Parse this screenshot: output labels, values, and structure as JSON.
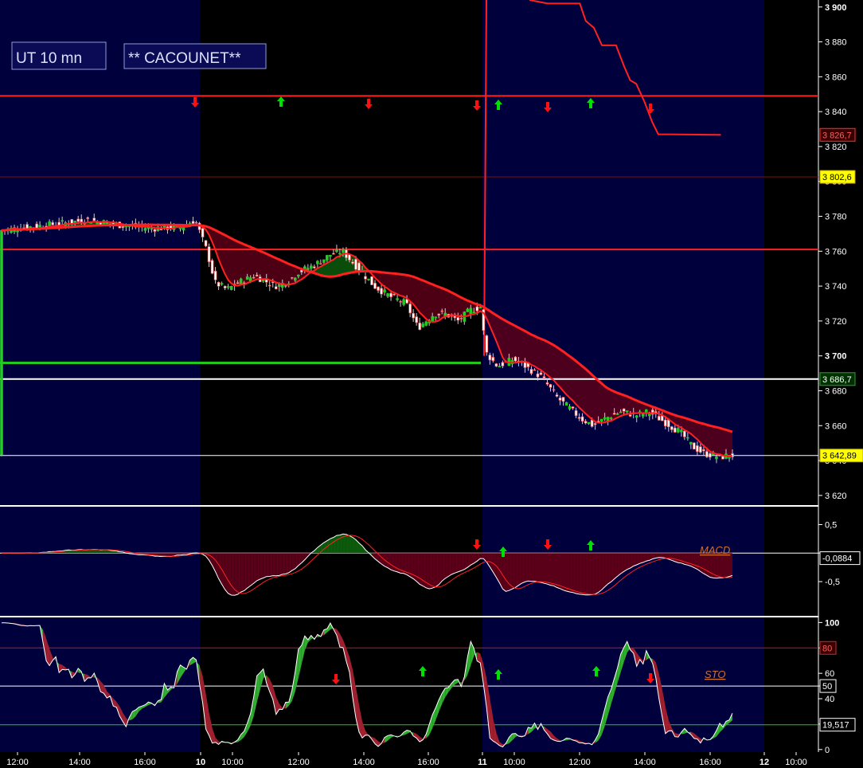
{
  "title": {
    "timeframe": "UT 10 mn",
    "name": "** CACOUNET**"
  },
  "colors": {
    "session_blue": "#00003d",
    "session_black": "#000000",
    "ma_red": "#ff2020",
    "ma_green": "#1ec81e",
    "cloud_red": "#5a0018",
    "cloud_green": "#0c5a0c",
    "up_arrow": "#00e000",
    "down_arrow": "#ff1010",
    "price_label_bg": "#ffff00"
  },
  "chart_data": [
    {
      "type": "line",
      "panel": "price",
      "y_ticks": [
        "3 900",
        "3 880",
        "3 860",
        "3 840",
        "3 820",
        "3 800",
        "3 780",
        "3 760",
        "3 740",
        "3 720",
        "3 700",
        "3 680",
        "3 660",
        "3 640",
        "3 620"
      ],
      "ylim": [
        3614,
        3904
      ],
      "horizontal_levels": [
        3849,
        3802.6,
        3761,
        3696,
        3686.7,
        3642.89
      ],
      "price_labels": [
        {
          "text": "3 826,7",
          "value": 3826.7,
          "style": "dark-red"
        },
        {
          "text": "3 802,6",
          "value": 3802.6,
          "style": "yellow"
        },
        {
          "text": "3 686,7",
          "value": 3686.7,
          "style": "dark-green"
        },
        {
          "text": "3 642,89",
          "value": 3642.89,
          "style": "yellow"
        }
      ],
      "series": [
        {
          "kind": "step-line",
          "points": [
            [
              0.0,
              3904
            ],
            [
              0.09,
              3902
            ],
            [
              0.25,
              3902
            ],
            [
              0.28,
              3892
            ],
            [
              0.32,
              3888
            ],
            [
              0.36,
              3878
            ],
            [
              0.43,
              3878
            ],
            [
              0.47,
              3866
            ],
            [
              0.5,
              3858
            ],
            [
              0.53,
              3856
            ],
            [
              0.57,
              3846
            ],
            [
              0.61,
              3834
            ],
            [
              0.64,
              3827
            ],
            [
              0.7,
              3827
            ],
            [
              0.95,
              3826.7
            ]
          ]
        }
      ]
    },
    {
      "type": "line",
      "panel": "macd",
      "y_ticks": [
        "0,5",
        "0",
        "-0,5"
      ],
      "ylim": [
        -1.1,
        0.8
      ],
      "current_value": "-0,0884",
      "label": "MACD"
    },
    {
      "type": "line",
      "panel": "stochastic",
      "y_ticks": [
        "100",
        "80",
        "60",
        "50",
        "40",
        "20",
        "0"
      ],
      "ylim": [
        -2,
        104
      ],
      "levels": [
        {
          "text": "80",
          "value": 80
        },
        {
          "text": "50",
          "value": 50
        }
      ],
      "current_value": "19,517",
      "label": "STO"
    }
  ],
  "x_axis": {
    "ticks": [
      {
        "label": "12:00",
        "bold": false
      },
      {
        "label": "14:00",
        "bold": false
      },
      {
        "label": "16:00",
        "bold": false
      },
      {
        "label": "10",
        "bold": true
      },
      {
        "label": "10:00",
        "bold": false
      },
      {
        "label": "12:00",
        "bold": false
      },
      {
        "label": "14:00",
        "bold": false
      },
      {
        "label": "16:00",
        "bold": false
      },
      {
        "label": "11",
        "bold": true
      },
      {
        "label": "10:00",
        "bold": false
      },
      {
        "label": "12:00",
        "bold": false
      },
      {
        "label": "14:00",
        "bold": false
      },
      {
        "label": "16:00",
        "bold": false
      },
      {
        "label": "12",
        "bold": true
      },
      {
        "label": "10:00",
        "bold": false
      }
    ]
  },
  "signals": [
    {
      "panel": "price",
      "dir": "down"
    },
    {
      "panel": "price",
      "dir": "up"
    },
    {
      "panel": "price",
      "dir": "down"
    },
    {
      "panel": "price",
      "dir": "down"
    },
    {
      "panel": "price",
      "dir": "up"
    },
    {
      "panel": "price",
      "dir": "down"
    },
    {
      "panel": "price",
      "dir": "up"
    },
    {
      "panel": "price",
      "dir": "down"
    },
    {
      "panel": "macd",
      "dir": "down"
    },
    {
      "panel": "macd",
      "dir": "up"
    },
    {
      "panel": "macd",
      "dir": "down"
    },
    {
      "panel": "macd",
      "dir": "up"
    },
    {
      "panel": "stochastic",
      "dir": "down"
    },
    {
      "panel": "stochastic",
      "dir": "up"
    },
    {
      "panel": "stochastic",
      "dir": "up"
    },
    {
      "panel": "stochastic",
      "dir": "up"
    },
    {
      "panel": "stochastic",
      "dir": "down"
    }
  ]
}
